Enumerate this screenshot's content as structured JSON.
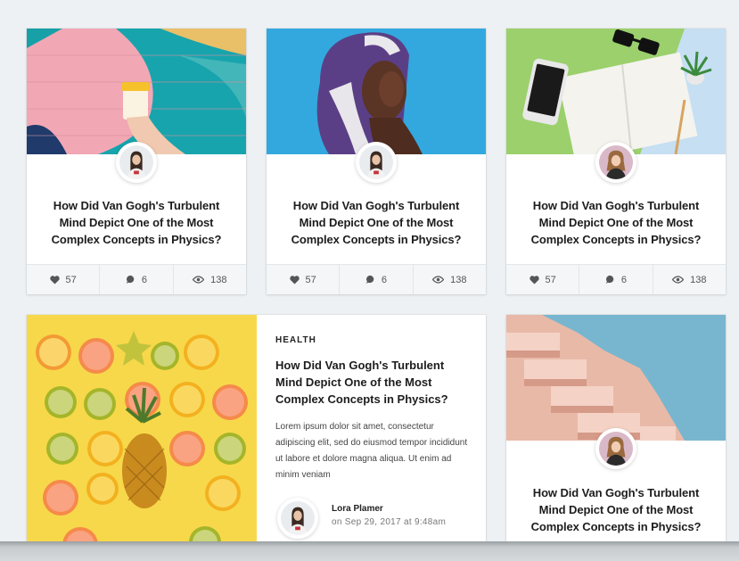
{
  "cards": [
    {
      "title": "How Did Van Gogh's Turbulent Mind Depict One of the Most Complex Concepts in Physics?",
      "likes": "57",
      "comments": "6",
      "views": "138"
    },
    {
      "title": "How Did Van Gogh's Turbulent Mind Depict One of the Most Complex Concepts in Physics?",
      "likes": "57",
      "comments": "6",
      "views": "138"
    },
    {
      "title": "How Did Van Gogh's Turbulent Mind Depict One of the Most Complex Concepts in Physics?",
      "likes": "57",
      "comments": "6",
      "views": "138"
    }
  ],
  "featured": {
    "category": "HEALTH",
    "title": "How Did Van Gogh's Turbulent Mind Depict One of the Most Complex Concepts in Physics?",
    "excerpt": "Lorem ipsum dolor sit amet, consectetur adipiscing elit, sed do eiusmod tempor incididunt ut labore et dolore magna aliqua. Ut enim ad minim veniam",
    "author": "Lora Plamer",
    "date": "on Sep 29, 2017 at 9:48am"
  },
  "side_card": {
    "title": "How Did Van Gogh's Turbulent Mind Depict One of the Most Complex Concepts in Physics?"
  },
  "icons": {
    "likes": "heart-icon",
    "comments": "comment-icon",
    "views": "eye-icon"
  },
  "colors": {
    "background": "#eef1f3",
    "stats_bar": "#f4f6f7",
    "text": "#1d1d1d"
  }
}
